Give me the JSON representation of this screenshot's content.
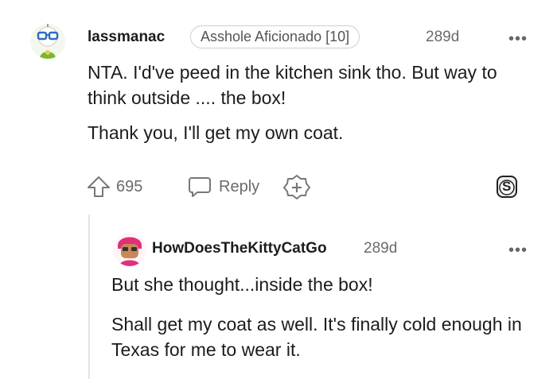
{
  "comments": [
    {
      "username": "lassmanac",
      "flair": "Asshole Aficionado [10]",
      "age": "289d",
      "more": "•••",
      "paragraphs": [
        "NTA. I'd've peed in the kitchen sink tho. But way to think outside .... the box!",
        "Thank you, I'll get my own coat."
      ],
      "votes": "695",
      "reply_label": "Reply",
      "award_badge": "S"
    },
    {
      "username": "HowDoesTheKittyCatGo",
      "age": "289d",
      "more": "•••",
      "paragraphs": [
        "But she thought...inside the box!",
        "Shall get my coat as well. It's finally cold enough in Texas for me to wear it."
      ]
    }
  ],
  "colors": {
    "avatar1_bg": "#dff0c8",
    "avatar2_hair": "#e0307a",
    "meta_gray": "#6b6b6b"
  }
}
